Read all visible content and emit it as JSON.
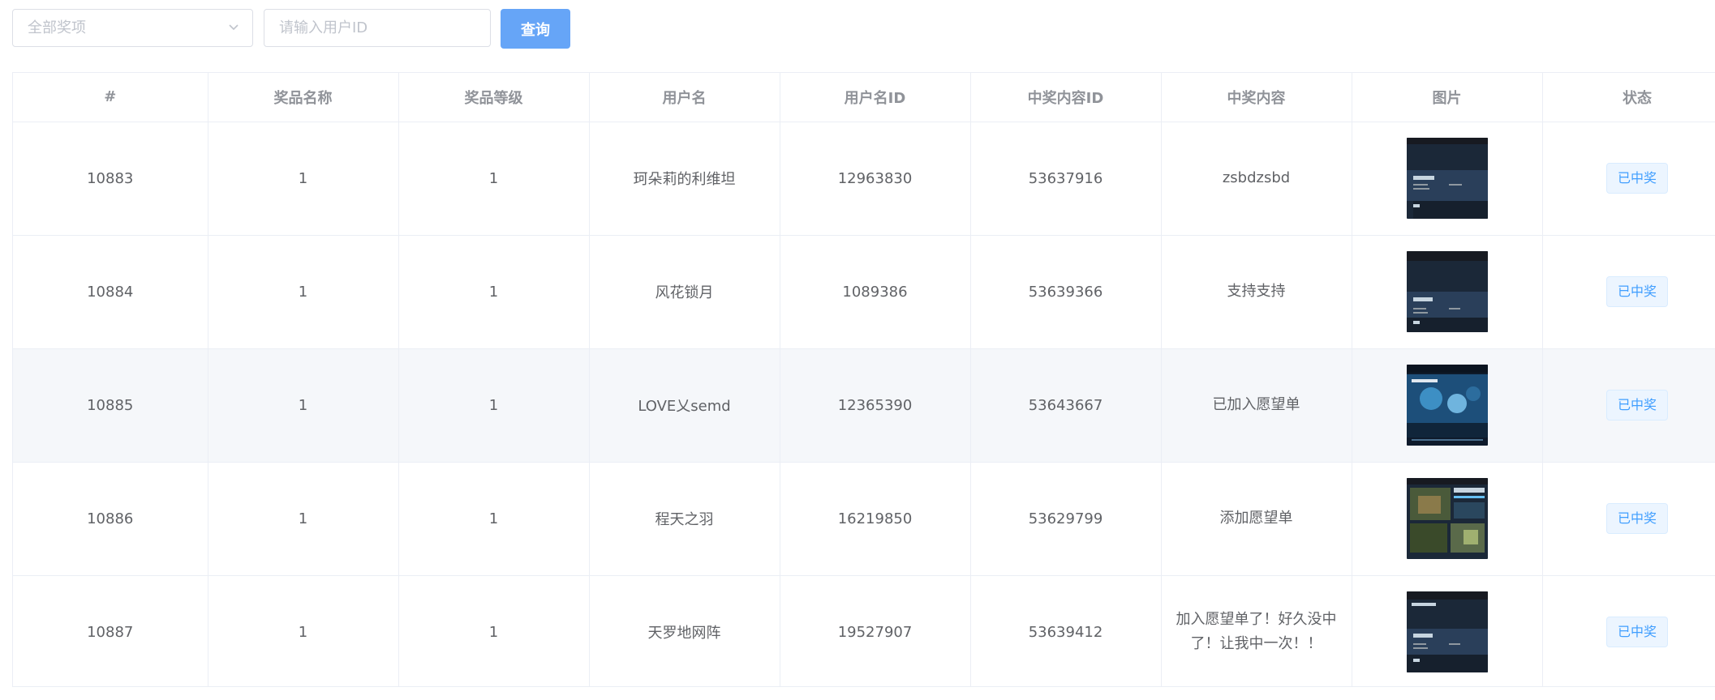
{
  "filter": {
    "prize_select": {
      "placeholder": "全部奖项"
    },
    "user_id_input": {
      "placeholder": "请输入用户ID",
      "value": ""
    },
    "query_label": "查询"
  },
  "table": {
    "headers": [
      "#",
      "奖品名称",
      "奖品等级",
      "用户名",
      "用户名ID",
      "中奖内容ID",
      "中奖内容",
      "图片",
      "状态"
    ],
    "rows": [
      {
        "id": "10883",
        "prize_name": "1",
        "prize_level": "1",
        "username": "珂朵莉的利维坦",
        "user_id": "12963830",
        "content_id": "53637916",
        "content": "zsbdzsbd",
        "image": "screenshot-thumbnail-icon",
        "status": "已中奖"
      },
      {
        "id": "10884",
        "prize_name": "1",
        "prize_level": "1",
        "username": "风花锁月",
        "user_id": "1089386",
        "content_id": "53639366",
        "content": "支持支持",
        "image": "screenshot-thumbnail-icon",
        "status": "已中奖"
      },
      {
        "id": "10885",
        "prize_name": "1",
        "prize_level": "1",
        "username": "LOVE乂semd",
        "user_id": "12365390",
        "content_id": "53643667",
        "content": "已加入愿望单",
        "image": "screenshot-thumbnail-icon",
        "status": "已中奖"
      },
      {
        "id": "10886",
        "prize_name": "1",
        "prize_level": "1",
        "username": "程天之羽",
        "user_id": "16219850",
        "content_id": "53629799",
        "content": "添加愿望单",
        "image": "screenshot-thumbnail-icon",
        "status": "已中奖"
      },
      {
        "id": "10887",
        "prize_name": "1",
        "prize_level": "1",
        "username": "天罗地网阵",
        "user_id": "19527907",
        "content_id": "53639412",
        "content": "加入愿望单了！好久没中了！让我中一次！！",
        "image": "screenshot-thumbnail-icon",
        "status": "已中奖"
      }
    ]
  },
  "colors": {
    "primary_button": "#66a5f7",
    "tag_text": "#409eff",
    "tag_bg": "#ecf5ff",
    "border": "#ebeef5",
    "row_hover": "#f5f7fa"
  },
  "icons": {
    "select_arrow": "chevron-down-icon"
  }
}
